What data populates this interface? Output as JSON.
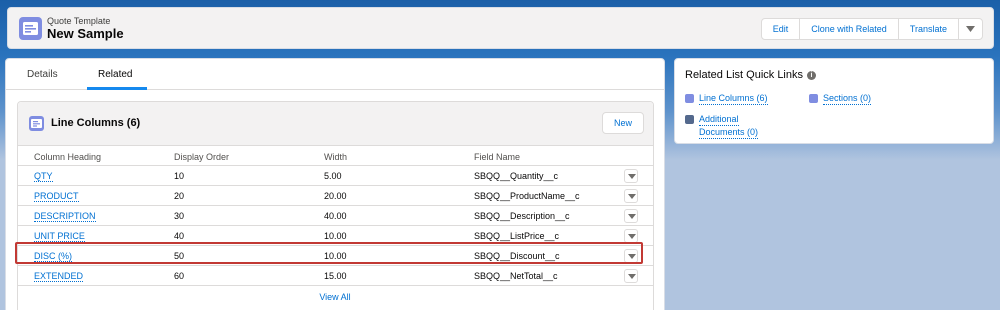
{
  "header": {
    "object_type": "Quote Template",
    "record_name": "New Sample",
    "actions": [
      "Edit",
      "Clone with Related",
      "Translate"
    ],
    "more_icon": "chevron-down-icon"
  },
  "tabs": [
    {
      "label": "Details",
      "active": false
    },
    {
      "label": "Related",
      "active": true
    }
  ],
  "related_list": {
    "title": "Line Columns (6)",
    "new_label": "New",
    "columns": [
      "Column Heading",
      "Display Order",
      "Width",
      "Field Name"
    ],
    "rows": [
      {
        "heading": "QTY",
        "order": "10",
        "width": "5.00",
        "field": "SBQQ__Quantity__c"
      },
      {
        "heading": "PRODUCT",
        "order": "20",
        "width": "20.00",
        "field": "SBQQ__ProductName__c"
      },
      {
        "heading": "DESCRIPTION",
        "order": "30",
        "width": "40.00",
        "field": "SBQQ__Description__c"
      },
      {
        "heading": "UNIT PRICE",
        "order": "40",
        "width": "10.00",
        "field": "SBQQ__ListPrice__c"
      },
      {
        "heading": "DISC (%)",
        "order": "50",
        "width": "10.00",
        "field": "SBQQ__Discount__c"
      },
      {
        "heading": "EXTENDED",
        "order": "60",
        "width": "15.00",
        "field": "SBQQ__NetTotal__c"
      }
    ],
    "highlighted_row": "DISC (%)",
    "view_all": "View All"
  },
  "quick_links": {
    "title": "Related List Quick Links",
    "links": [
      {
        "label": "Line Columns (6)",
        "icon": "list-icon",
        "color": "#7f8de1"
      },
      {
        "label": "Sections (0)",
        "icon": "list-icon",
        "color": "#7f8de1"
      },
      {
        "label_line1": "Additional",
        "label_line2": "Documents (0)",
        "icon": "wrench-icon",
        "color": "#54698d"
      }
    ]
  },
  "colors": {
    "brand_blue": "#0070d2",
    "highlight_red": "#c23934",
    "object_icon": "#7f8de1"
  }
}
